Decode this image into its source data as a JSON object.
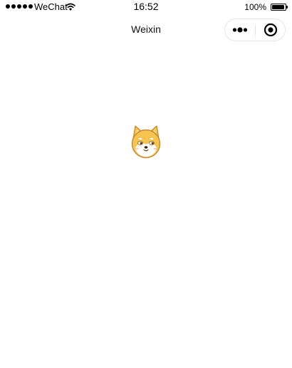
{
  "status_bar": {
    "carrier": "WeChat",
    "time": "16:52",
    "battery_percent": "100%",
    "battery_level": 1.0,
    "signal_icon": "signal-dots-icon",
    "wifi_icon": "wifi-icon",
    "battery_icon": "battery-icon"
  },
  "nav_bar": {
    "title": "Weixin",
    "more_icon": "more-dots-icon",
    "close_icon": "target-close-icon"
  },
  "content": {
    "loading_image": "shiba-dog-icon"
  },
  "colors": {
    "background": "#ffffff",
    "text": "#000000",
    "capsule_border": "#e6e6e6",
    "dog_fur": "#f5c451",
    "dog_outline": "#c8892a",
    "dog_face": "#ffffff"
  }
}
